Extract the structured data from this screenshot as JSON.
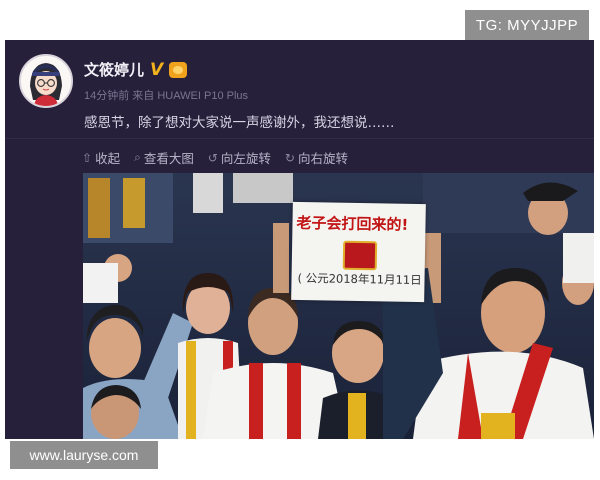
{
  "tg_badge": "TG: MYYJJPP",
  "post": {
    "username": "文筱婷儿",
    "meta": "14分钟前 来自 HUAWEI P10 Plus",
    "text": "感恩节，除了想对大家说一声感谢外，我还想说……",
    "verified_icon": "V",
    "actions": [
      {
        "icon": "thumb-up-icon",
        "label": "收起"
      },
      {
        "icon": "search-icon",
        "label": "查看大图"
      },
      {
        "icon": "rotate-left-icon",
        "label": "向左旋转"
      },
      {
        "icon": "rotate-right-icon",
        "label": "向右旋转"
      }
    ],
    "photo": {
      "sign_line1": "老子会打回来的!",
      "sign_line2": "( 公元2018年11月11日 )"
    }
  },
  "watermark": "www.lauryse.com",
  "colors": {
    "card_bg": "#26203b",
    "verified": "#f2b21b",
    "sign_text": "#c21414",
    "badge_bg": "#8f8f8f"
  }
}
